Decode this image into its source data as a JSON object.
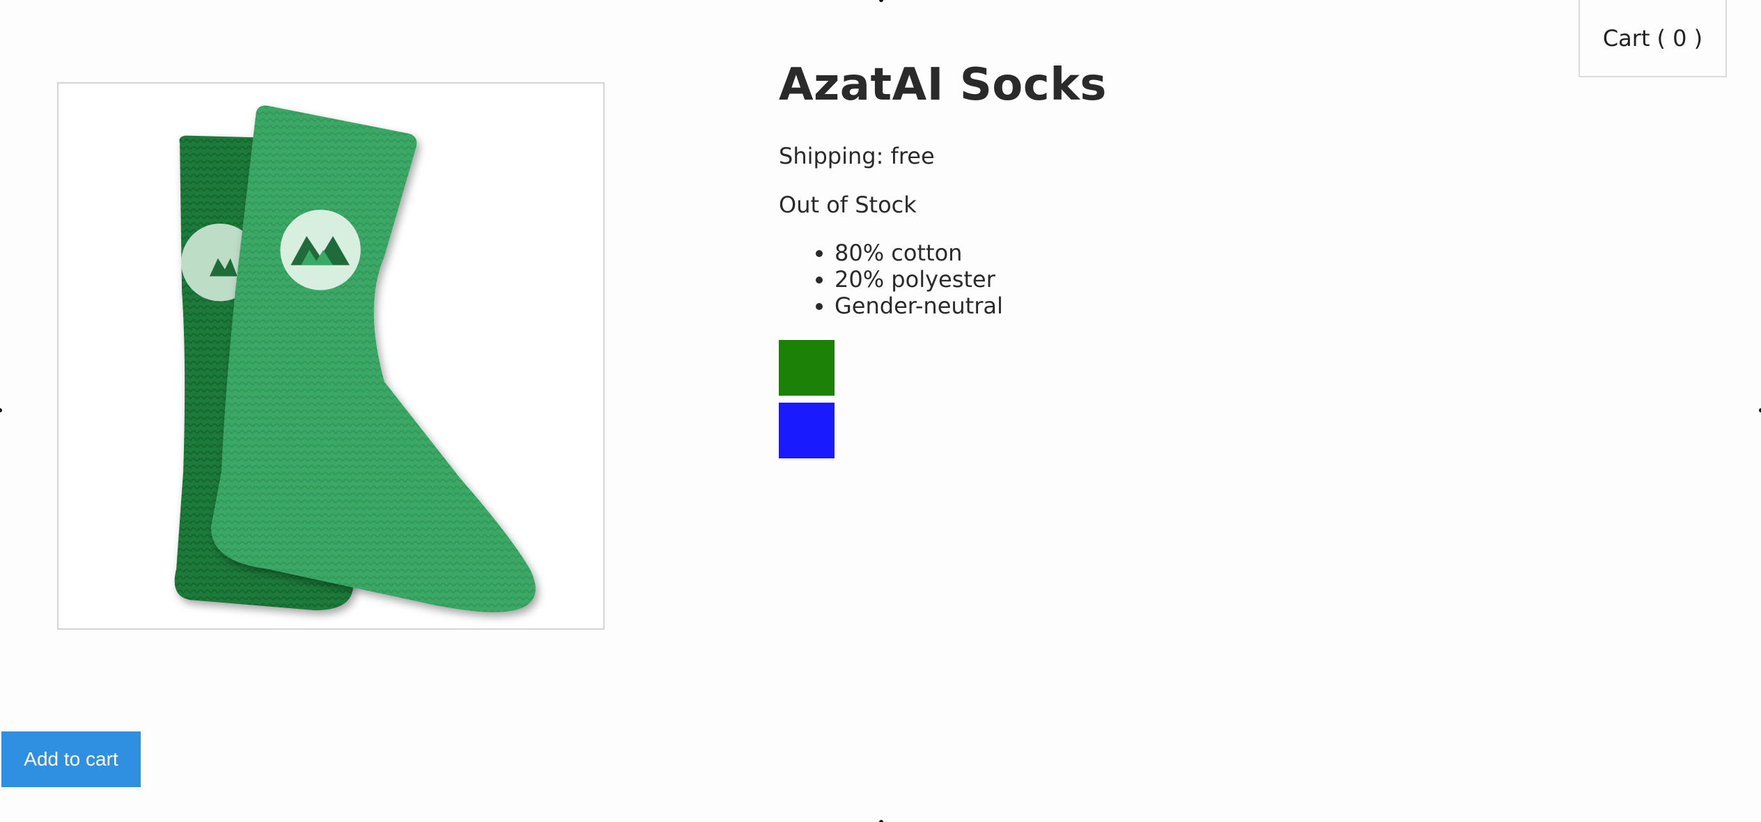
{
  "cart": {
    "label": "Cart",
    "count_text": "( 0 )"
  },
  "product": {
    "image_icon": "green-socks-image",
    "title": "AzatAI Socks",
    "shipping": "Shipping: free",
    "stock": "Out of Stock",
    "features": [
      "80% cotton",
      "20% polyester",
      "Gender-neutral"
    ],
    "variants": [
      {
        "name": "green",
        "color": "#1b8107"
      },
      {
        "name": "blue",
        "color": "#1a1aff"
      }
    ]
  },
  "actions": {
    "add_to_cart": "Add to cart",
    "add_to_cart_color": "#2f8fe0"
  }
}
